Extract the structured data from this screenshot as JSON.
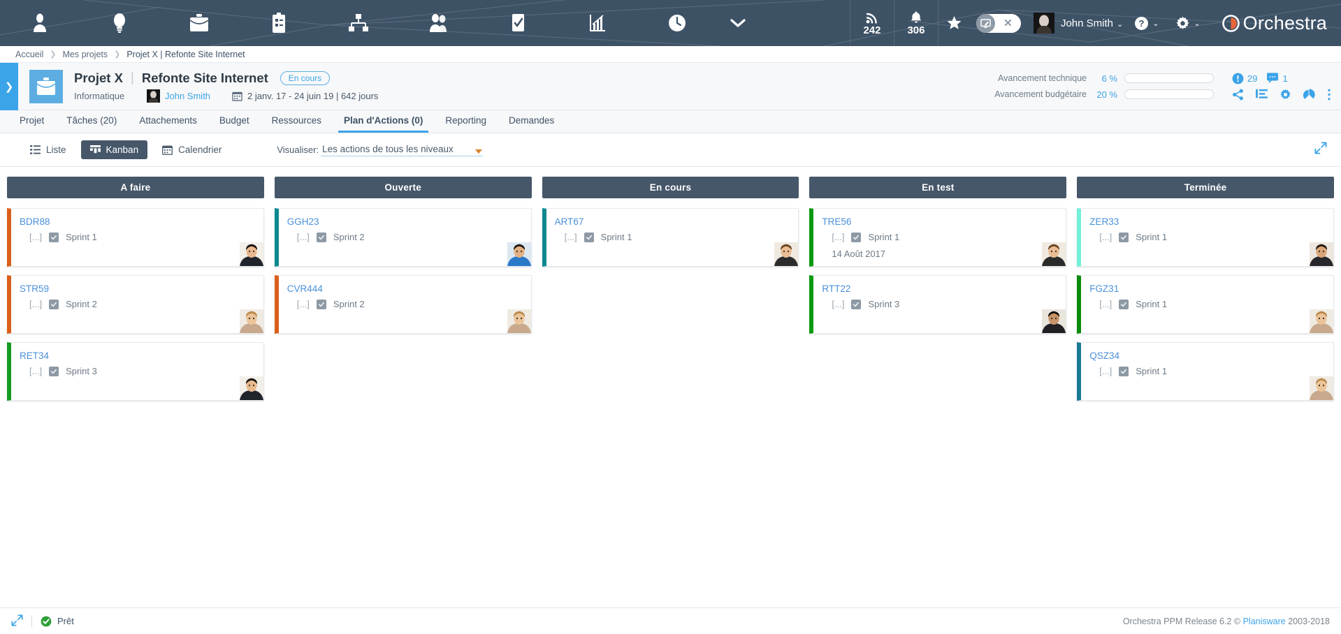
{
  "topbar": {
    "nav_icons": [
      {
        "name": "user-icon",
        "label": "Utilisateur"
      },
      {
        "name": "lightbulb-idea-icon",
        "label": "Idées"
      },
      {
        "name": "briefcase-portfolio-icon",
        "label": "Portefeuille"
      },
      {
        "name": "clipboard-project-icon",
        "label": "Projets"
      },
      {
        "name": "org-chart-icon",
        "label": "Organisation"
      },
      {
        "name": "people-resources-icon",
        "label": "Ressources"
      },
      {
        "name": "checkbox-tasks-icon",
        "label": "Tâches"
      },
      {
        "name": "bar-chart-reporting-icon",
        "label": "Reporting"
      },
      {
        "name": "clock-timesheet-icon",
        "label": "Temps"
      }
    ],
    "more_caret": "chevron-down-icon",
    "rss_count": "242",
    "bell_count": "306",
    "star": "star-icon",
    "toggle_on_icon": "screen-edit-icon",
    "toggle_off_icon": "close-x-icon",
    "user_name": "John Smith",
    "help_icon": "question-circle-icon",
    "settings_icon": "gear-icon",
    "logo_text": "Orchestra",
    "accent_color": "#e8663c",
    "bar_color": "#3e5266"
  },
  "breadcrumb": {
    "items": [
      "Accueil",
      "Mes projets",
      "Projet X | Refonte Site Internet"
    ]
  },
  "project": {
    "side_toggle_icon": "chevron-right-icon",
    "icon": "briefcase-icon",
    "code": "Projet X",
    "divider": "|",
    "name": "Refonte Site Internet",
    "status": "En cours",
    "department": "Informatique",
    "owner": "John Smith",
    "calendar_icon": "calendar-icon",
    "dates": "2 janv. 17 - 24 juin 19 | 642 jours",
    "progress": [
      {
        "label": "Avancement technique",
        "value": "6 %",
        "percent": 6
      },
      {
        "label": "Avancement budgétaire",
        "value": "20 %",
        "percent": 20
      }
    ],
    "alerts": {
      "icon": "alert-exclamation-icon",
      "count": "29"
    },
    "comments": {
      "icon": "comment-bubble-icon",
      "count": "1"
    },
    "action_icons": [
      {
        "name": "share-icon"
      },
      {
        "name": "indent-list-icon"
      },
      {
        "name": "settings-gear-icon"
      },
      {
        "name": "pie-chart-icon"
      },
      {
        "name": "more-vertical-icon"
      }
    ]
  },
  "tabs": [
    {
      "label": "Projet",
      "active": false
    },
    {
      "label": "Tâches (20)",
      "active": false
    },
    {
      "label": "Attachements",
      "active": false
    },
    {
      "label": "Budget",
      "active": false
    },
    {
      "label": "Ressources",
      "active": false
    },
    {
      "label": "Plan d'Actions (0)",
      "active": true
    },
    {
      "label": "Reporting",
      "active": false
    },
    {
      "label": "Demandes",
      "active": false
    }
  ],
  "view_toolbar": {
    "buttons": [
      {
        "label": "Liste",
        "icon": "list-icon",
        "active": false
      },
      {
        "label": "Kanban",
        "icon": "kanban-grid-icon",
        "active": true
      },
      {
        "label": "Calendrier",
        "icon": "calendar-icon",
        "active": false
      }
    ],
    "visualiser_label": "Visualiser:",
    "visualiser_value": "Les actions de tous les niveaux",
    "expand_icon": "expand-arrows-icon"
  },
  "kanban": {
    "columns": [
      {
        "title": "A faire",
        "cards": [
          {
            "id": "BDR88",
            "ellipsis": "[...]",
            "sprint": "Sprint 1",
            "date": "",
            "accent": "#d9601a",
            "avatar": "male-asian"
          },
          {
            "id": "STR59",
            "ellipsis": "[...]",
            "sprint": "Sprint 2",
            "date": "",
            "accent": "#d9601a",
            "avatar": "female-blonde"
          },
          {
            "id": "RET34",
            "ellipsis": "[...]",
            "sprint": "Sprint 3",
            "date": "",
            "accent": "#159c22",
            "avatar": "male-asian"
          }
        ]
      },
      {
        "title": "Ouverte",
        "cards": [
          {
            "id": "GGH23",
            "ellipsis": "[...]",
            "sprint": "Sprint 2",
            "date": "",
            "accent": "#0d8a8f",
            "avatar": "male-blue"
          },
          {
            "id": "CVR444",
            "ellipsis": "[...]",
            "sprint": "Sprint 2",
            "date": "",
            "accent": "#d9601a",
            "avatar": "female-blonde"
          }
        ]
      },
      {
        "title": "En cours",
        "cards": [
          {
            "id": "ART67",
            "ellipsis": "[...]",
            "sprint": "Sprint 1",
            "date": "",
            "accent": "#0d8a8f",
            "avatar": "female-brown"
          }
        ]
      },
      {
        "title": "En test",
        "cards": [
          {
            "id": "TRE56",
            "ellipsis": "[...]",
            "sprint": "Sprint 1",
            "date": "14 Août 2017",
            "accent": "#0b9a10",
            "avatar": "female-brown"
          },
          {
            "id": "RTT22",
            "ellipsis": "[...]",
            "sprint": "Sprint 3",
            "date": "",
            "accent": "#0b9a10",
            "avatar": "male-dark"
          }
        ]
      },
      {
        "title": "Terminée",
        "cards": [
          {
            "id": "ZER33",
            "ellipsis": "[...]",
            "sprint": "Sprint 1",
            "date": "",
            "accent": "#72f0d8",
            "avatar": "female-dark"
          },
          {
            "id": "FGZ31",
            "ellipsis": "[...]",
            "sprint": "Sprint 1",
            "date": "",
            "accent": "#0b8a0b",
            "avatar": "female-blonde"
          },
          {
            "id": "QSZ34",
            "ellipsis": "[...]",
            "sprint": "Sprint 1",
            "date": "",
            "accent": "#1a7a96",
            "avatar": "female-blonde"
          }
        ]
      }
    ]
  },
  "footer": {
    "expand_icon": "expand-diagonal-icon",
    "status_icon": "check-circle-green-icon",
    "status_text": "Prêt",
    "copyright_pre": "Orchestra PPM Release 6.2 © ",
    "copyright_link": "Planisware",
    "copyright_post": " 2003-2018"
  }
}
